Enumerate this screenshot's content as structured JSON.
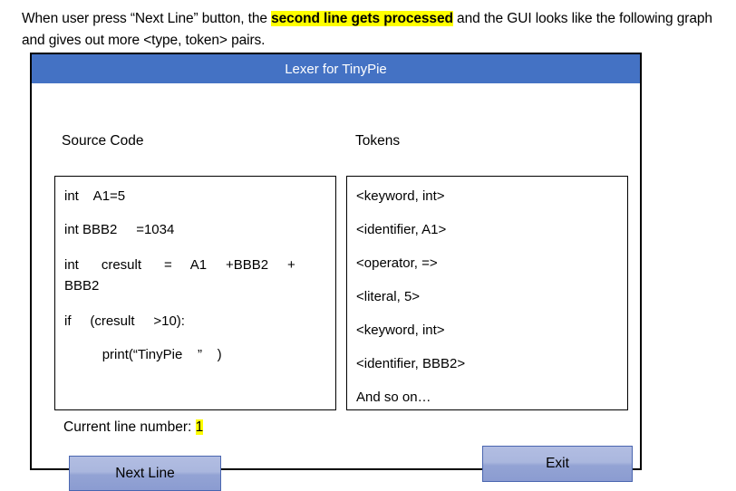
{
  "intro": {
    "before_highlight": "When user press “Next Line” button, the ",
    "highlight": "second line gets processed",
    "after_highlight": " and the GUI looks like the following graph and gives out more <type, token> pairs."
  },
  "window": {
    "title": "Lexer for TinyPie",
    "title_bar_color": "#4472C4"
  },
  "labels": {
    "source_code": "Source Code",
    "tokens": "Tokens"
  },
  "source_code_panel": {
    "lines": [
      "int    A1=5",
      "int BBB2     =1034",
      "int      cresult      =     A1     +BBB2     +  BBB2",
      "if     (cresult     >10):",
      "          print(“TinyPie    ”    )"
    ]
  },
  "tokens_panel": {
    "lines": [
      "<keyword, int>",
      "<identifier, A1>",
      "<operator, =>",
      "<literal, 5>",
      "<keyword, int>",
      "<identifier, BBB2>",
      "And so on…"
    ]
  },
  "status": {
    "label": "Current line number: ",
    "value": "1",
    "highlight_color": "#FFFF00"
  },
  "buttons": {
    "next_line": "Next Line",
    "exit": "Exit"
  }
}
